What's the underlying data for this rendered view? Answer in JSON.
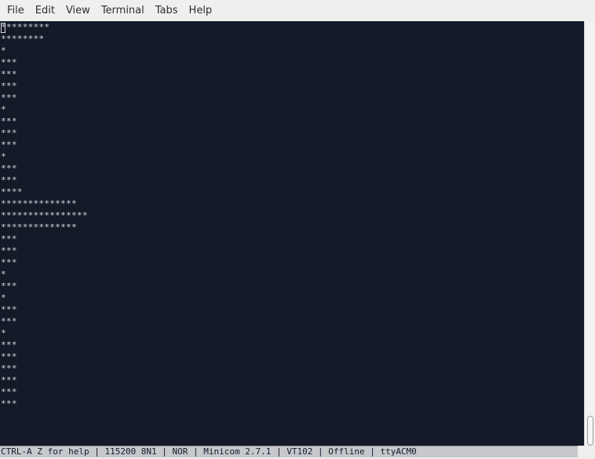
{
  "menu": {
    "items": [
      {
        "label": "File"
      },
      {
        "label": "Edit"
      },
      {
        "label": "View"
      },
      {
        "label": "Terminal"
      },
      {
        "label": "Tabs"
      },
      {
        "label": "Help"
      }
    ]
  },
  "terminal": {
    "lines": [
      "*********",
      "********",
      "*",
      "***",
      "***",
      "***",
      "***",
      "*",
      "***",
      "***",
      "***",
      "*",
      "***",
      "***",
      "****",
      "**************",
      "****************",
      "**************",
      "***",
      "***",
      "***",
      "*",
      "***",
      "*",
      "***",
      "***",
      "*",
      "***",
      "***",
      "***",
      "***",
      "***",
      "***"
    ]
  },
  "status": {
    "text": "CTRL-A Z for help | 115200 8N1 | NOR | Minicom 2.7.1 | VT102 | Offline | ttyACM0"
  }
}
